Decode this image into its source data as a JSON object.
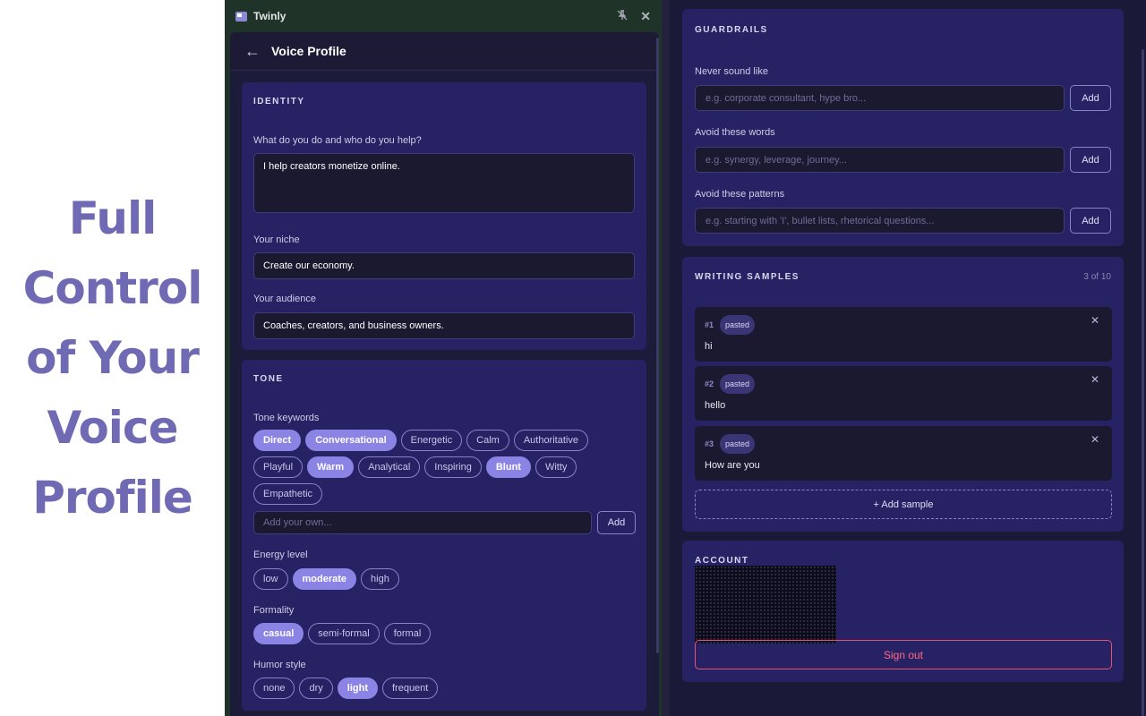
{
  "hero": {
    "lines": [
      "Full",
      "Control",
      "of Your",
      "Voice",
      "Profile"
    ]
  },
  "app": {
    "title": "Twinly"
  },
  "panel": {
    "title": "Voice Profile"
  },
  "identity": {
    "heading": "IDENTITY",
    "q1_label": "What do you do and who do you help?",
    "q1_value": "I help creators monetize online.",
    "niche_label": "Your niche",
    "niche_value": "Create our economy.",
    "audience_label": "Your audience",
    "audience_value": "Coaches, creators, and business owners."
  },
  "tone": {
    "heading": "TONE",
    "keywords_label": "Tone keywords",
    "keywords": [
      {
        "label": "Direct",
        "selected": true
      },
      {
        "label": "Conversational",
        "selected": true
      },
      {
        "label": "Energetic",
        "selected": false
      },
      {
        "label": "Calm",
        "selected": false
      },
      {
        "label": "Authoritative",
        "selected": false
      },
      {
        "label": "Playful",
        "selected": false
      },
      {
        "label": "Warm",
        "selected": true
      },
      {
        "label": "Analytical",
        "selected": false
      },
      {
        "label": "Inspiring",
        "selected": false
      },
      {
        "label": "Blunt",
        "selected": true
      },
      {
        "label": "Witty",
        "selected": false
      },
      {
        "label": "Empathetic",
        "selected": false
      }
    ],
    "add_placeholder": "Add your own...",
    "add_label": "Add",
    "energy_label": "Energy level",
    "energy": [
      {
        "label": "low",
        "selected": false
      },
      {
        "label": "moderate",
        "selected": true
      },
      {
        "label": "high",
        "selected": false
      }
    ],
    "formality_label": "Formality",
    "formality": [
      {
        "label": "casual",
        "selected": true
      },
      {
        "label": "semi-formal",
        "selected": false
      },
      {
        "label": "formal",
        "selected": false
      }
    ],
    "humor_label": "Humor style",
    "humor": [
      {
        "label": "none",
        "selected": false
      },
      {
        "label": "dry",
        "selected": false
      },
      {
        "label": "light",
        "selected": true
      },
      {
        "label": "frequent",
        "selected": false
      }
    ]
  },
  "guardrails": {
    "heading": "GUARDRAILS",
    "never_label": "Never sound like",
    "never_placeholder": "e.g. corporate consultant, hype bro...",
    "words_label": "Avoid these words",
    "words_placeholder": "e.g. synergy, leverage, journey...",
    "patterns_label": "Avoid these patterns",
    "patterns_placeholder": "e.g. starting with 'I', bullet lists, rhetorical questions...",
    "add_label": "Add"
  },
  "samples": {
    "heading": "WRITING SAMPLES",
    "count": "3 of 10",
    "items": [
      {
        "num": "#1",
        "badge": "pasted",
        "text": "hi"
      },
      {
        "num": "#2",
        "badge": "pasted",
        "text": "hello"
      },
      {
        "num": "#3",
        "badge": "pasted",
        "text": "How are you"
      }
    ],
    "add_label": "+ Add sample"
  },
  "account": {
    "heading": "ACCOUNT",
    "sign_out": "Sign out"
  },
  "colors": {
    "accent": "#8b84e5",
    "card": "#262263",
    "field": "#1a1930",
    "danger": "#e5536f"
  }
}
